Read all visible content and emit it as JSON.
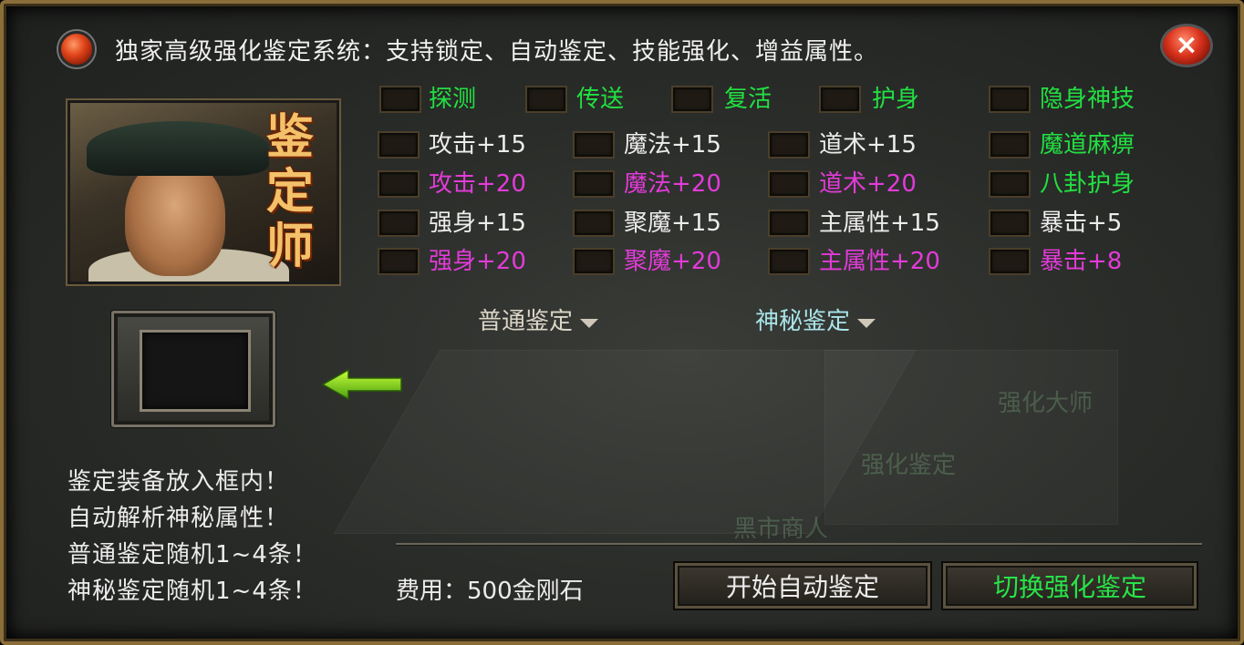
{
  "title": "独家高级强化鉴定系统：支持锁定、自动鉴定、技能强化、增益属性。",
  "close_glyph": "×",
  "portrait_title": [
    "鉴",
    "定",
    "师"
  ],
  "skills": [
    {
      "label": "探测"
    },
    {
      "label": "传送"
    },
    {
      "label": "复活"
    },
    {
      "label": "护身"
    },
    {
      "label": "隐身神技"
    }
  ],
  "attrs": [
    [
      {
        "label": "攻击+15"
      },
      {
        "label": "魔法+15"
      },
      {
        "label": "道术+15"
      },
      {
        "label": "魔道麻痹"
      }
    ],
    [
      {
        "label": "攻击+20"
      },
      {
        "label": "魔法+20"
      },
      {
        "label": "道术+20"
      },
      {
        "label": "八卦护身"
      }
    ],
    [
      {
        "label": "强身+15"
      },
      {
        "label": "聚魔+15"
      },
      {
        "label": "主属性+15"
      },
      {
        "label": "暴击+5"
      }
    ],
    [
      {
        "label": "强身+20"
      },
      {
        "label": "聚魔+20"
      },
      {
        "label": "主属性+20"
      },
      {
        "label": "暴击+8"
      }
    ]
  ],
  "dropdowns": {
    "normal": "普通鉴定",
    "mystic": "神秘鉴定"
  },
  "info_lines": [
    "鉴定装备放入框内！",
    "自动解析神秘属性！",
    "普通鉴定随机1~4条！",
    "神秘鉴定随机1~4条！"
  ],
  "cost": "费用：500金刚石",
  "buttons": {
    "auto": "开始自动鉴定",
    "switch": "切换强化鉴定"
  },
  "background_text": [
    "强化大师",
    "强化鉴定",
    "黑市商人"
  ],
  "colors": {
    "green": "#22e042",
    "white": "#ececec",
    "magenta": "#e23bd8",
    "frame": "#8a6e3a"
  },
  "icons": {
    "title": "red-gem-icon",
    "close": "close-icon",
    "arrow": "left-arrow-icon"
  }
}
